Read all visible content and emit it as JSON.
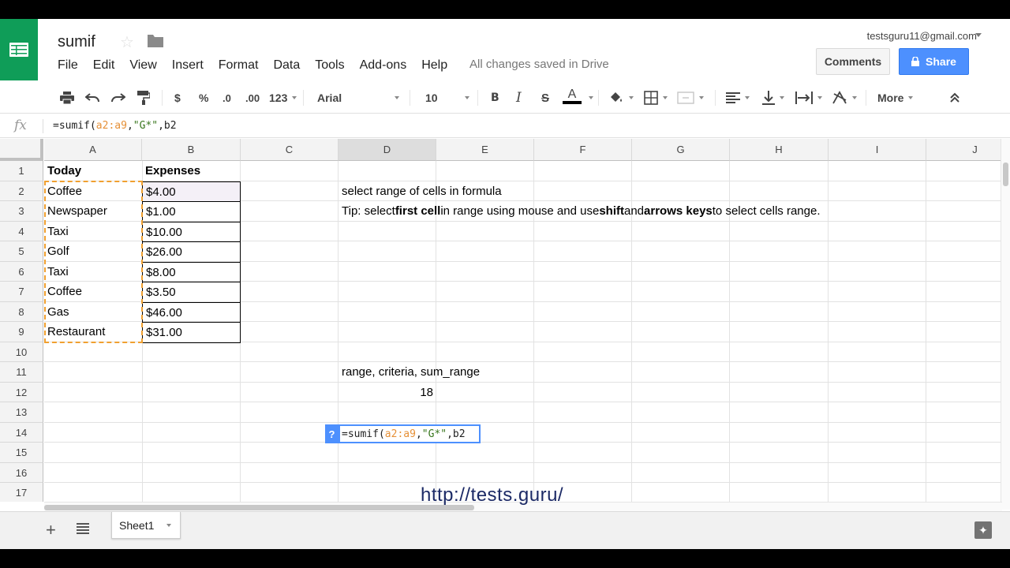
{
  "app": {
    "title": "sumif",
    "account": "testsguru11@gmail.com",
    "saved_status": "All changes saved in Drive",
    "comments_label": "Comments",
    "share_label": "Share",
    "accent": "#4d90fe",
    "brand": "#0f9d58"
  },
  "menu": [
    "File",
    "Edit",
    "View",
    "Insert",
    "Format",
    "Data",
    "Tools",
    "Add-ons",
    "Help"
  ],
  "toolbar": {
    "currency": "$",
    "percent": "%",
    "decimal_dec": ".0",
    "decimal_inc": ".00",
    "number_format": "123",
    "font": "Arial",
    "font_size": "10",
    "bold": "B",
    "italic": "I",
    "strike": "S",
    "text_color": "A",
    "more": "More"
  },
  "formula_bar": {
    "fx": "fx",
    "parts": [
      "=sumif(",
      "a2:a9",
      ",",
      "\"G*\"",
      ",b2"
    ]
  },
  "columns": [
    "A",
    "B",
    "C",
    "D",
    "E",
    "F",
    "G",
    "H",
    "I",
    "J"
  ],
  "rows": [
    "1",
    "2",
    "3",
    "4",
    "5",
    "6",
    "7",
    "8",
    "9",
    "10",
    "11",
    "12",
    "13",
    "14",
    "15",
    "16",
    "17"
  ],
  "table": {
    "headers": [
      "Today",
      "Expenses"
    ],
    "items": [
      {
        "item": "Coffee",
        "amount": "$4.00"
      },
      {
        "item": "Newspaper",
        "amount": "$1.00"
      },
      {
        "item": "Taxi",
        "amount": "$10.00"
      },
      {
        "item": "Golf",
        "amount": "$26.00"
      },
      {
        "item": "Taxi",
        "amount": "$8.00"
      },
      {
        "item": "Coffee",
        "amount": "$3.50"
      },
      {
        "item": "Gas",
        "amount": "$46.00"
      },
      {
        "item": "Restaurant",
        "amount": "$31.00"
      }
    ]
  },
  "notes": {
    "d2": "select range of cells in formula",
    "d3_parts": [
      "Tip: select ",
      "first cell",
      " in range using mouse and use ",
      "shift",
      " and ",
      "arrows keys",
      " to select cells range."
    ],
    "d10": "range, criteria, sum_range",
    "d11": "18"
  },
  "editor": {
    "help": "?",
    "parts": [
      "=sumif(",
      "a2:a9",
      ",",
      "\"G*\"",
      ",b2"
    ]
  },
  "watermark": "http://tests.guru/",
  "sheet_tab": "Sheet1"
}
